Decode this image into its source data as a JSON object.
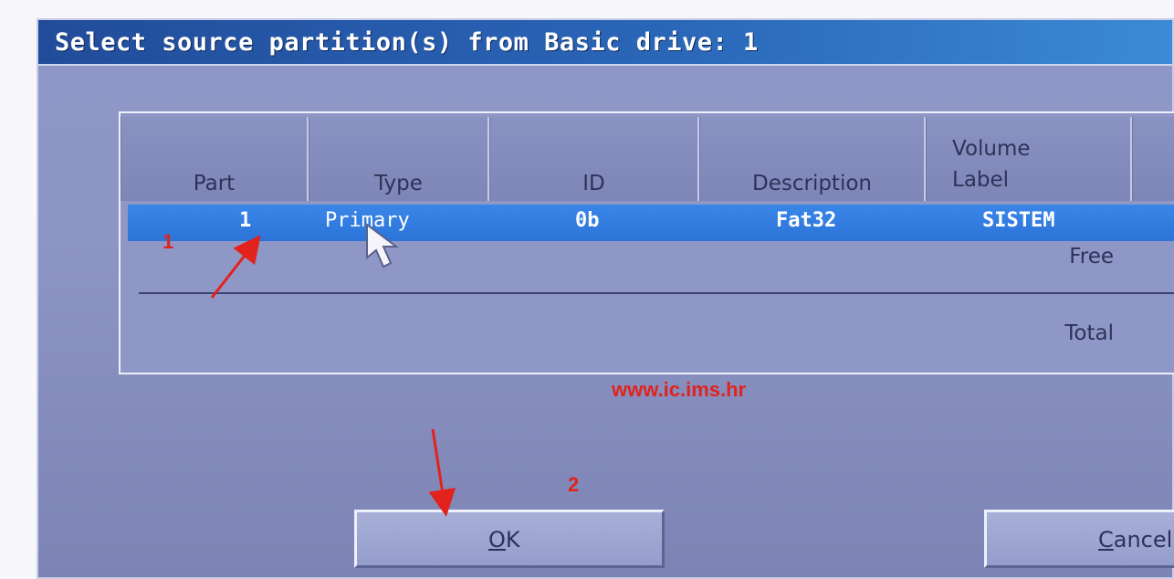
{
  "dialog": {
    "title": "Select source partition(s) from Basic drive: 1",
    "columns": [
      "Part",
      "Type",
      "ID",
      "Description",
      "Volume\nLabel"
    ],
    "selected_row": {
      "part": "1",
      "type": "Primary",
      "id": "0b",
      "description": "Fat32",
      "volume_label": "SISTEM"
    },
    "free_label": "Free",
    "total_label": "Total",
    "buttons": {
      "ok": "OK",
      "cancel": "Cancel"
    }
  },
  "annotations": {
    "watermark": "www.ic.ims.hr",
    "step1": "1",
    "step2": "2",
    "color": "#e2221c"
  },
  "icons": [
    "mouse-cursor-icon",
    "red-arrow-icon"
  ]
}
